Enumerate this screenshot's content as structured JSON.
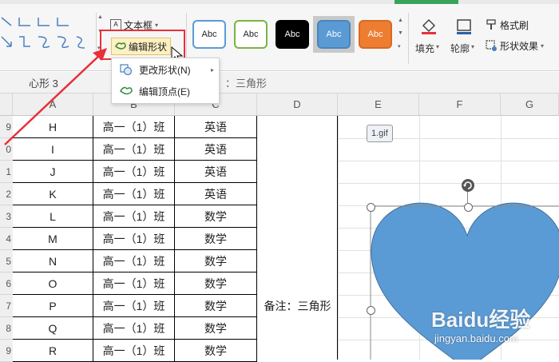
{
  "ribbon": {
    "textbox_label": "文本框",
    "edit_shape_label": "编辑形状",
    "style_buttons": [
      {
        "label": "Abc"
      },
      {
        "label": "Abc"
      },
      {
        "label": "Abc"
      },
      {
        "label": "Abc"
      },
      {
        "label": "Abc"
      }
    ],
    "fill_label": "填充",
    "outline_label": "轮廓",
    "format_brush_label": "格式刷",
    "shape_effects_label": "形状效果"
  },
  "menu": {
    "items": [
      {
        "label": "更改形状(N)"
      },
      {
        "label": "编辑顶点(E)"
      }
    ]
  },
  "formula_bar": {
    "name_box": "心形 3",
    "fx_content": "：三角形"
  },
  "sheet": {
    "columns": [
      "A",
      "B",
      "C",
      "D",
      "E",
      "F",
      "G"
    ],
    "rows": [
      {
        "num": "9",
        "a": "H",
        "b": "高一（1）班",
        "c": "英语"
      },
      {
        "num": "0",
        "a": "I",
        "b": "高一（1）班",
        "c": "英语"
      },
      {
        "num": "1",
        "a": "J",
        "b": "高一（1）班",
        "c": "英语"
      },
      {
        "num": "2",
        "a": "K",
        "b": "高一（1）班",
        "c": "英语"
      },
      {
        "num": "3",
        "a": "L",
        "b": "高一（1）班",
        "c": "数学"
      },
      {
        "num": "4",
        "a": "M",
        "b": "高一（1）班",
        "c": "数学"
      },
      {
        "num": "5",
        "a": "N",
        "b": "高一（1）班",
        "c": "数学"
      },
      {
        "num": "6",
        "a": "O",
        "b": "高一（1）班",
        "c": "数学"
      },
      {
        "num": "7",
        "a": "P",
        "b": "高一（1）班",
        "c": "数学"
      },
      {
        "num": "8",
        "a": "Q",
        "b": "高一（1）班",
        "c": "数学"
      },
      {
        "num": "9",
        "a": "R",
        "b": "高一（1）班",
        "c": "数学"
      }
    ],
    "note": "备注：三角形",
    "gif_label": "1.gif"
  },
  "watermark": {
    "brand": "Baidu经验",
    "url": "jingyan.baidu.com"
  },
  "colors": {
    "heart_fill": "#5b9bd5",
    "highlight_red": "#e8303a",
    "selected_style": "#5b9bd5",
    "orange_style": "#ed7d31"
  }
}
